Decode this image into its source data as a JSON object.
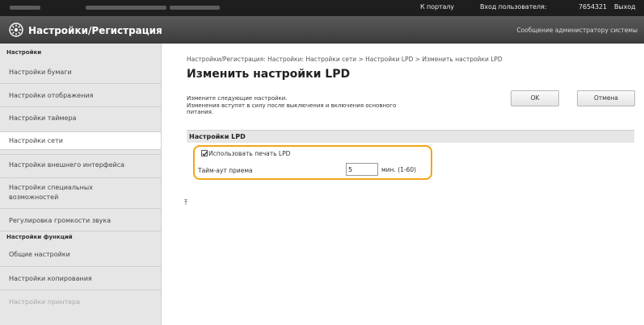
{
  "topbar": {
    "portal_link": "К порталу",
    "login_label": "Вход пользователя:",
    "login_user": "7654321",
    "logout_link": "Выход"
  },
  "header": {
    "title": "Настройки/Регистрация",
    "admin_message": "Сообщение администратору системы",
    "icon": "gear-icon"
  },
  "sidebar": {
    "section1": "Настройки",
    "items1": [
      "Настройки бумаги",
      "Настройки отображения",
      "Настройки таймера",
      "Настройки сети",
      "Настройки внешнего интерфейса",
      "Настройки специальных",
      "возможностей",
      "Регулировка громкости звука"
    ],
    "section2": "Настройки функций",
    "items2": [
      "Общие настройки",
      "Настройки копирования",
      "Настройки принтера"
    ]
  },
  "main": {
    "breadcrumb": "Настройки/Регистрация: Настройки: Настройки сети > Настройки LPD > Изменить настройки LPD",
    "title": "Изменить настройки LPD",
    "desc_line1": "Измените следующие настройки.",
    "desc_line2": "Изменения вступят в силу после выключения и включения основного",
    "desc_line3": "питания.",
    "ok_label": "OK",
    "cancel_label": "Отмена",
    "section_title": "Настройки LPD",
    "use_lpd_label": "Использовать печать LPD",
    "use_lpd_checked": true,
    "timeout_label": "Тайм-аут приема",
    "timeout_value": "5",
    "timeout_unit": "мин. (1-60)",
    "highlight_color": "#f2a519"
  }
}
